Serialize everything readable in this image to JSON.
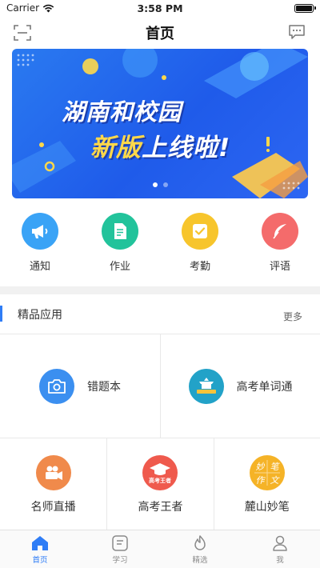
{
  "status_bar": {
    "carrier": "Carrier",
    "time": "3:58 PM"
  },
  "navbar": {
    "title": "首页",
    "left_icon": "scan-icon",
    "right_icon": "message-icon"
  },
  "banner": {
    "line1": "湖南和校园",
    "line2_highlight": "新版",
    "line2_rest": "上线啦!",
    "page_count": 2,
    "active_page": 1
  },
  "quick_actions": [
    {
      "label": "通知",
      "icon": "megaphone-icon",
      "color": "#3aa3f6"
    },
    {
      "label": "作业",
      "icon": "document-icon",
      "color": "#22c39b"
    },
    {
      "label": "考勤",
      "icon": "checkbox-icon",
      "color": "#f7c52c"
    },
    {
      "label": "评语",
      "icon": "feather-icon",
      "color": "#f46b6b"
    }
  ],
  "section": {
    "title": "精品应用",
    "more": "更多"
  },
  "apps_row1": [
    {
      "label": "错题本",
      "icon": "camera-icon",
      "color": "#3b8ff0"
    },
    {
      "label": "高考单词通",
      "icon": "building-icon",
      "color": "#22a2c8"
    }
  ],
  "apps_row2": [
    {
      "label": "名师直播",
      "icon": "video-camera-icon",
      "color": "#f08a4b"
    },
    {
      "label": "高考王者",
      "icon": "graduation-cap-icon",
      "color": "#ef5a4d",
      "badge": "高考王者"
    },
    {
      "label": "麓山妙笔",
      "icon": "calligraphy-icon",
      "color": "#f5b327",
      "glyphs": [
        "妙",
        "笔",
        "作",
        "文"
      ]
    }
  ],
  "tabbar": [
    {
      "label": "首页",
      "icon": "home-icon",
      "active": true
    },
    {
      "label": "学习",
      "icon": "notebook-icon",
      "active": false
    },
    {
      "label": "精选",
      "icon": "flame-icon",
      "active": false
    },
    {
      "label": "我",
      "icon": "person-icon",
      "active": false
    }
  ],
  "colors": {
    "accent": "#2f7df6",
    "banner_blue": "#1f5bea",
    "banner_yellow": "#ffd84a"
  }
}
